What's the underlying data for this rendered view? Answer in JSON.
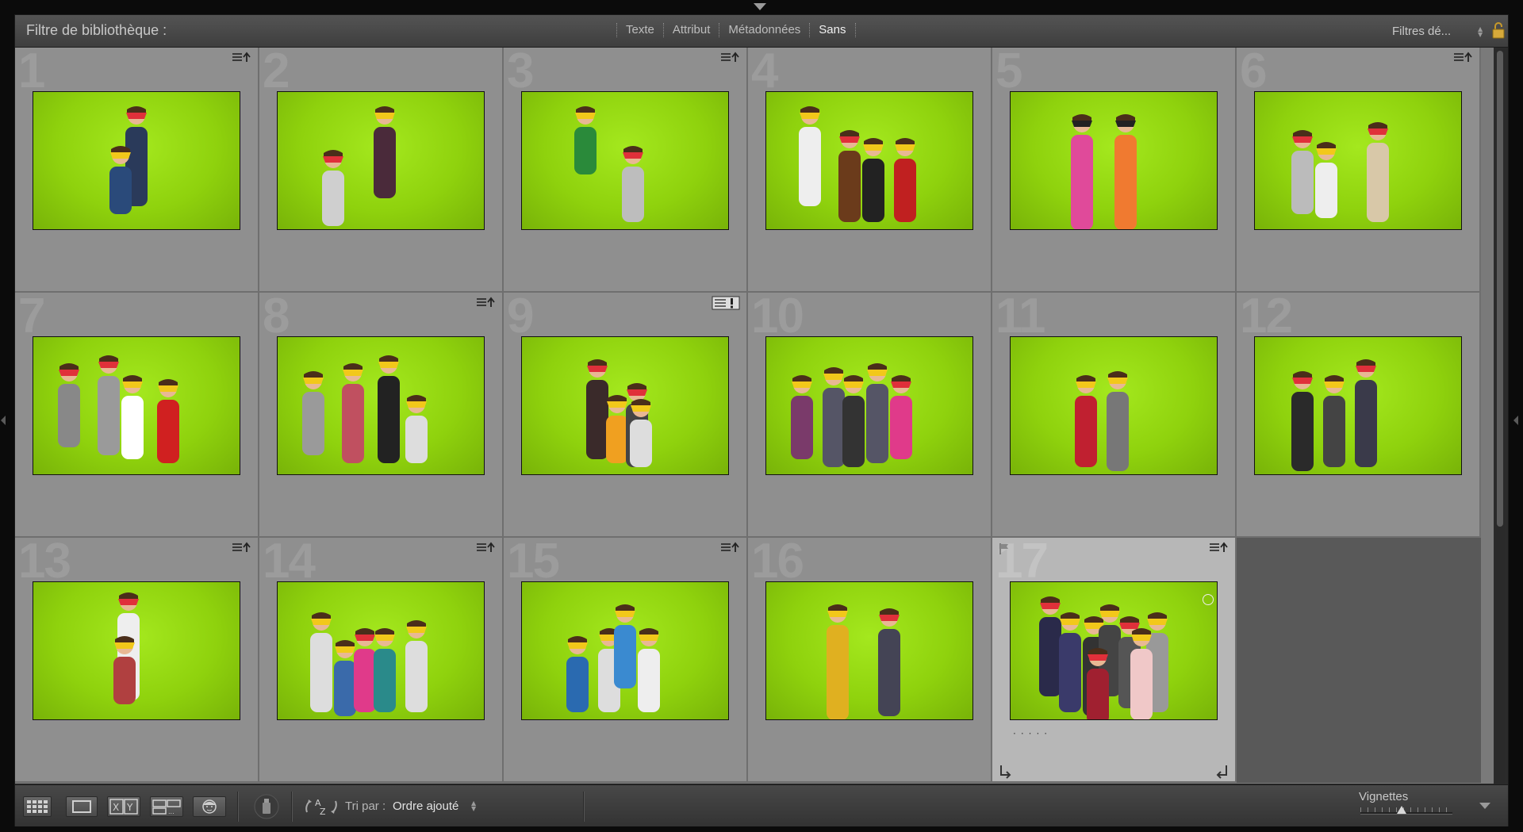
{
  "filter_bar": {
    "title": "Filtre de bibliothèque :",
    "tabs": [
      "Texte",
      "Attribut",
      "Métadonnées",
      "Sans"
    ],
    "active_tab": "Sans",
    "preset": "Filtres dé..."
  },
  "grid": {
    "cells": [
      {
        "number": "1",
        "badge": "metadata"
      },
      {
        "number": "2",
        "badge": ""
      },
      {
        "number": "3",
        "badge": "metadata"
      },
      {
        "number": "4",
        "badge": ""
      },
      {
        "number": "5",
        "badge": ""
      },
      {
        "number": "6",
        "badge": "metadata"
      },
      {
        "number": "7",
        "badge": ""
      },
      {
        "number": "8",
        "badge": "metadata"
      },
      {
        "number": "9",
        "badge": "warning"
      },
      {
        "number": "10",
        "badge": ""
      },
      {
        "number": "11",
        "badge": ""
      },
      {
        "number": "12",
        "badge": ""
      },
      {
        "number": "13",
        "badge": "metadata"
      },
      {
        "number": "14",
        "badge": "metadata"
      },
      {
        "number": "15",
        "badge": "metadata"
      },
      {
        "number": "16",
        "badge": ""
      },
      {
        "number": "17",
        "badge": "metadata",
        "selected": true
      }
    ]
  },
  "toolbar": {
    "sort_label": "Tri par :",
    "sort_value": "Ordre ajouté",
    "thumbnails_label": "Vignettes",
    "thumbnail_size_fraction": 0.45
  },
  "colors": {
    "photo_background": "#8fd20d",
    "mask_yellow": "#f2c81a",
    "mask_red": "#e0303a"
  }
}
